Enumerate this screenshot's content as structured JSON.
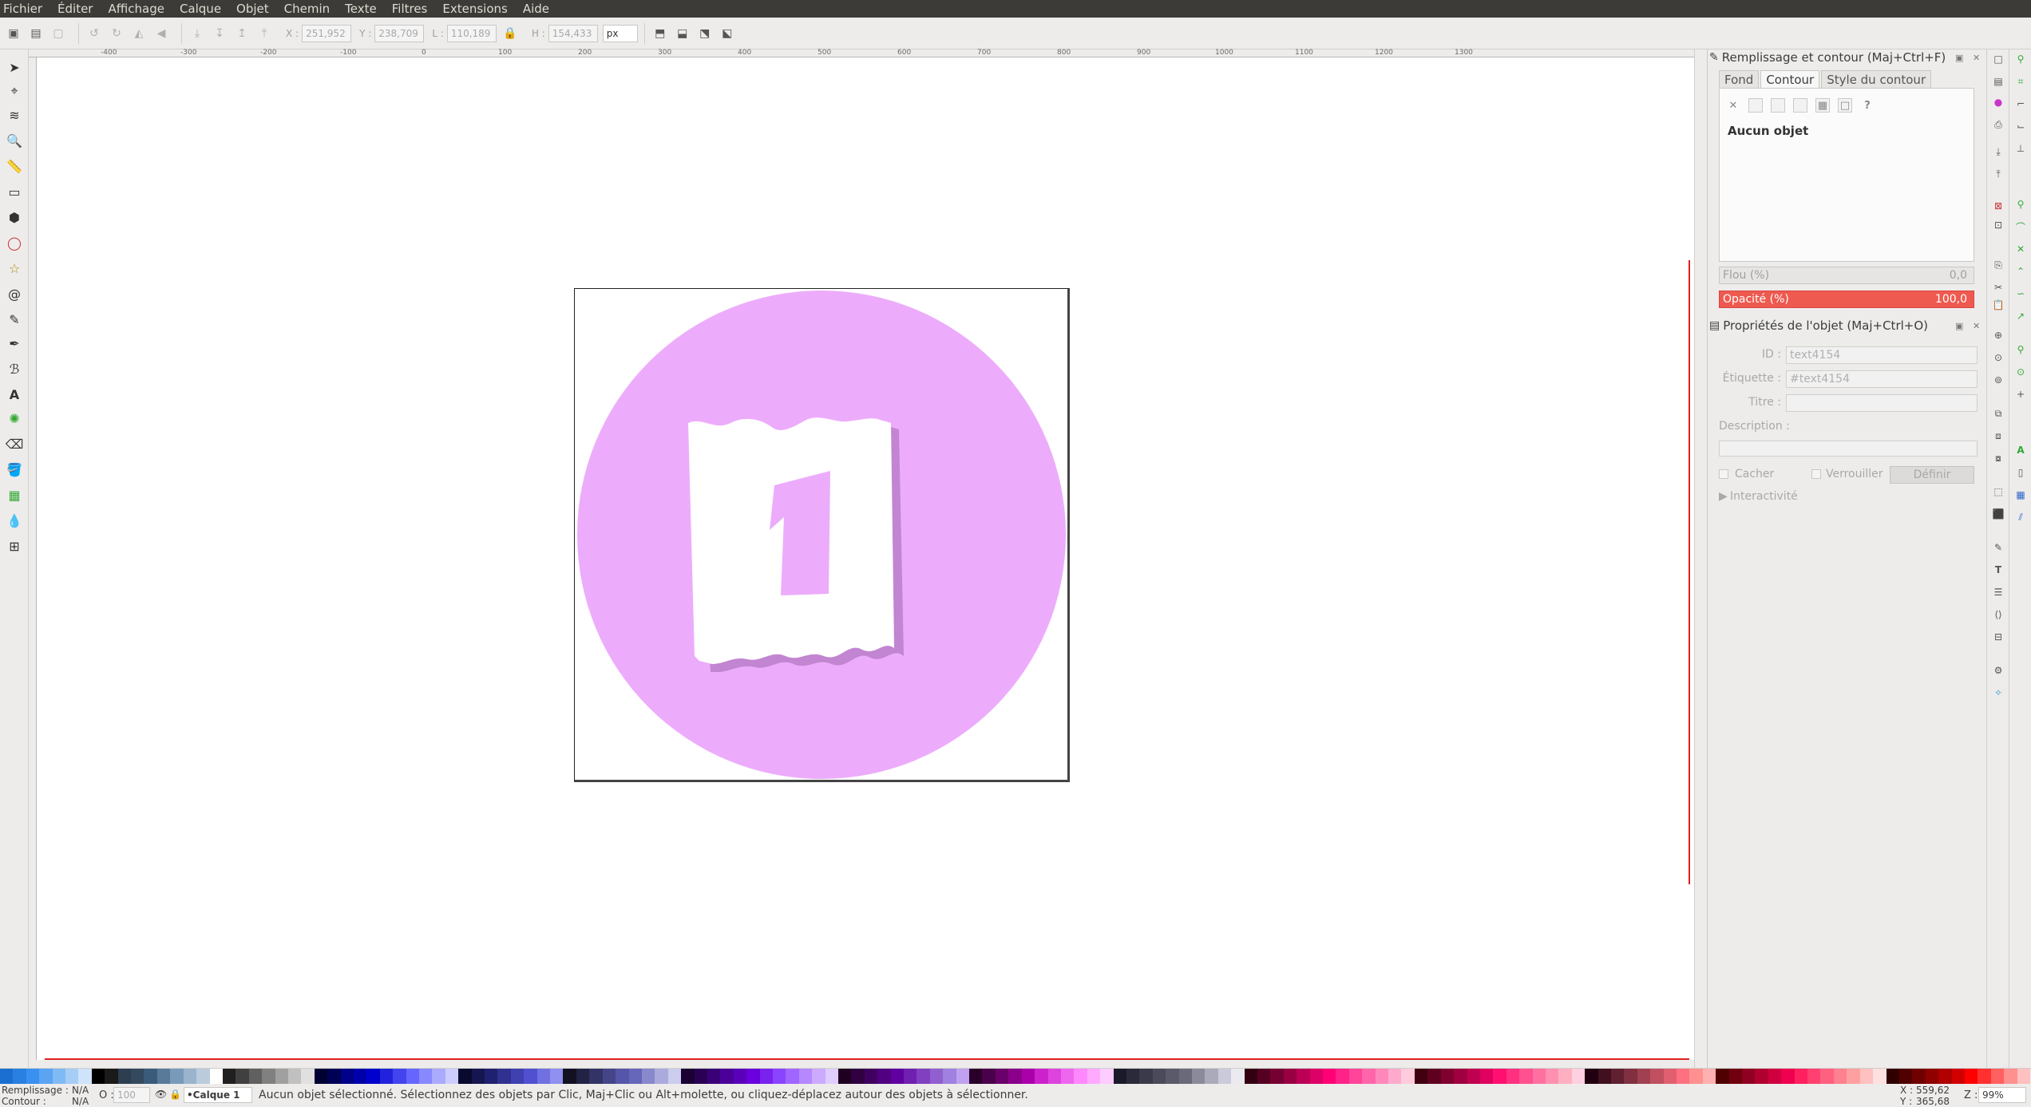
{
  "menu": [
    "Fichier",
    "Éditer",
    "Affichage",
    "Calque",
    "Objet",
    "Chemin",
    "Texte",
    "Filtres",
    "Extensions",
    "Aide"
  ],
  "toolbar": {
    "x_label": "X :",
    "x_value": "251,952",
    "y_label": "Y :",
    "y_value": "238,709",
    "w_label": "L :",
    "w_value": "110,189",
    "h_label": "H :",
    "h_value": "154,433",
    "unit": "px"
  },
  "ruler_labels": [
    "-400",
    "-300",
    "-200",
    "-100",
    "0",
    "100",
    "200",
    "300",
    "400",
    "500",
    "600",
    "700",
    "800",
    "900",
    "1000",
    "1100",
    "1200",
    "1300"
  ],
  "artwork": {
    "circle_color": "#ecacfb",
    "shadow_color": "#c285d1",
    "number": "1"
  },
  "fill_stroke": {
    "title": "Remplissage et contour (Maj+Ctrl+F)",
    "tabs": [
      "Fond",
      "Contour",
      "Style du contour"
    ],
    "no_object": "Aucun objet",
    "blur_label": "Flou (%)",
    "blur_value": "0,0",
    "opacity_label": "Opacité (%)",
    "opacity_value": "100,0"
  },
  "object_props": {
    "title": "Propriétés de l'objet (Maj+Ctrl+O)",
    "id_label": "ID :",
    "id_value": "text4154",
    "label_label": "Étiquette :",
    "label_value": "#text4154",
    "title_label": "Titre :",
    "title_value": "",
    "desc_label": "Description :",
    "hide_label": "Cacher",
    "lock_label": "Verrouiller",
    "set_label": "Définir",
    "interactivity_label": "Interactivité"
  },
  "status": {
    "fill_label": "Remplissage :",
    "fill_value": "N/A",
    "stroke_label": "Contour :",
    "stroke_value": "N/A",
    "opacity_label": "O :",
    "opacity_value": "100",
    "layer": "•Calque 1",
    "message": "Aucun objet sélectionné. Sélectionnez des objets par Clic, Maj+Clic ou Alt+molette, ou cliquez-déplacez autour des objets à sélectionner.",
    "x_label": "X :",
    "x_value": "559,62",
    "y_label": "Y :",
    "y_value": "365,68",
    "zoom_label": "Z :",
    "zoom_value": "99%"
  },
  "palette_colors": [
    "#1a6fd1",
    "#2a80e0",
    "#3a90ee",
    "#5aa4f2",
    "#80baf4",
    "#a6cdf6",
    "#cfe3fa",
    "#000000",
    "#1a1a1a",
    "#2c3e50",
    "#34495e",
    "#3b5b7a",
    "#5a7a9a",
    "#7a9aba",
    "#9ab4cc",
    "#bacbdc",
    "#ffffff",
    "#202020",
    "#404040",
    "#606060",
    "#808080",
    "#a0a0a0",
    "#c0c0c0",
    "#e0e0e0",
    "#000033",
    "#000055",
    "#000088",
    "#0000aa",
    "#0000cc",
    "#2222dd",
    "#4444ee",
    "#6666ff",
    "#8888ff",
    "#aaaaff",
    "#ccccff",
    "#0a0a30",
    "#151550",
    "#202070",
    "#303090",
    "#4040b0",
    "#5050d0",
    "#7070e0",
    "#9090f0",
    "#111122",
    "#222244",
    "#333366",
    "#444488",
    "#5555aa",
    "#6666bb",
    "#8888cc",
    "#aaaadd",
    "#ccccee",
    "#1a0033",
    "#2a0055",
    "#3a0077",
    "#4a0099",
    "#5a00bb",
    "#6a00dd",
    "#7a22ee",
    "#8a44ff",
    "#a066ff",
    "#b688ff",
    "#ccaaff",
    "#e0ccff",
    "#200020",
    "#300040",
    "#400060",
    "#500080",
    "#6000a0",
    "#7020b0",
    "#8040c0",
    "#9060d0",
    "#a080e0",
    "#c0a0f0",
    "#2a002a",
    "#4a004a",
    "#6a006a",
    "#8a008a",
    "#aa00aa",
    "#cc22cc",
    "#dd44dd",
    "#ee66ee",
    "#ff88ff",
    "#ffaaff",
    "#ffccff",
    "#1a1a2a",
    "#2a2a3a",
    "#3a3a4a",
    "#4a4a5a",
    "#5a5a6a",
    "#6a6a7a",
    "#8a8a9a",
    "#aaaaba",
    "#cacada",
    "#eaeaf0",
    "#330011",
    "#550022",
    "#770033",
    "#990044",
    "#bb0055",
    "#dd0066",
    "#ff0077",
    "#ff2288",
    "#ff4499",
    "#ff66aa",
    "#ff88bb",
    "#ffaacc",
    "#ffccdd",
    "#400010",
    "#600020",
    "#800030",
    "#a00040",
    "#c00050",
    "#e00060",
    "#ff1070",
    "#ff3080",
    "#ff5090",
    "#ff70a0",
    "#ff90b0",
    "#ffb0c0",
    "#ffd0e0",
    "#200010",
    "#401020",
    "#602030",
    "#803040",
    "#a04050",
    "#c05060",
    "#e06070",
    "#ff7080",
    "#ff9090",
    "#ffb0b0",
    "#500000",
    "#700010",
    "#900020",
    "#b00030",
    "#d00040",
    "#f00050",
    "#ff2060",
    "#ff4070",
    "#ff6080",
    "#ff8090",
    "#ffa0a0",
    "#ffc0c0",
    "#ffe0e0",
    "#300000",
    "#500000",
    "#700000",
    "#900000",
    "#b00000",
    "#d00000",
    "#ff0000",
    "#ff3030",
    "#ff6060",
    "#ff9090",
    "#ffc0c0"
  ]
}
